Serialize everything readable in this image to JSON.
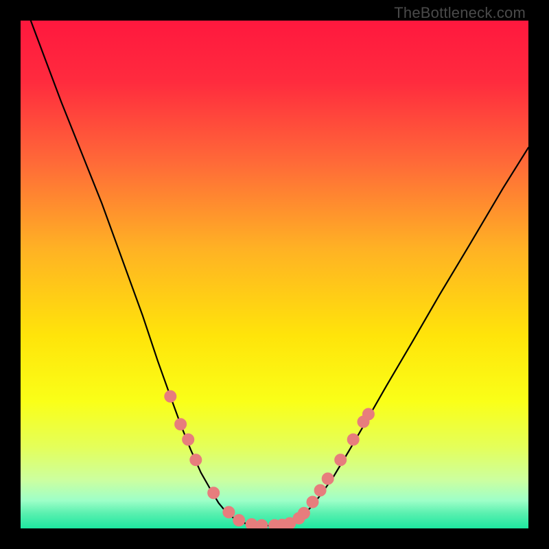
{
  "watermark": "TheBottleneck.com",
  "colors": {
    "bg": "#000000",
    "gradient_stops": [
      {
        "offset": 0.0,
        "color": "#ff183e"
      },
      {
        "offset": 0.12,
        "color": "#ff2b3e"
      },
      {
        "offset": 0.28,
        "color": "#ff6a38"
      },
      {
        "offset": 0.45,
        "color": "#ffb224"
      },
      {
        "offset": 0.62,
        "color": "#ffe40a"
      },
      {
        "offset": 0.75,
        "color": "#faff18"
      },
      {
        "offset": 0.84,
        "color": "#e4ff5a"
      },
      {
        "offset": 0.905,
        "color": "#ccffa0"
      },
      {
        "offset": 0.945,
        "color": "#9effc8"
      },
      {
        "offset": 0.97,
        "color": "#5af0b0"
      },
      {
        "offset": 1.0,
        "color": "#1de8a0"
      }
    ],
    "curve": "#000000",
    "marker_fill": "#e77d7d",
    "marker_stroke": "#e77d7d"
  },
  "chart_data": {
    "type": "line",
    "title": "",
    "xlabel": "",
    "ylabel": "",
    "xlim": [
      0,
      100
    ],
    "ylim": [
      0,
      100
    ],
    "series": [
      {
        "name": "left-curve",
        "x": [
          2,
          5,
          8,
          12,
          16,
          20,
          24,
          27,
          29.5,
          31.5,
          33.5,
          35.5,
          37.5,
          39,
          40.5,
          42,
          43.5,
          45
        ],
        "y": [
          100,
          92,
          84,
          74,
          64,
          53,
          42,
          33,
          26,
          20.5,
          15.5,
          11,
          7.5,
          5,
          3.2,
          2,
          1.2,
          0.8
        ]
      },
      {
        "name": "valley-floor",
        "x": [
          45,
          46.5,
          48,
          49.5,
          51,
          52.5
        ],
        "y": [
          0.8,
          0.6,
          0.55,
          0.55,
          0.6,
          0.8
        ]
      },
      {
        "name": "right-curve",
        "x": [
          52.5,
          54,
          55.5,
          57,
          59,
          61.5,
          64.5,
          68,
          72,
          77,
          82.5,
          88.5,
          95,
          100
        ],
        "y": [
          0.8,
          1.4,
          2.5,
          4,
          6.5,
          10,
          15,
          21,
          28,
          36.5,
          46,
          56,
          67,
          75
        ]
      }
    ],
    "markers": {
      "name": "highlighted-points",
      "points": [
        {
          "x": 29.5,
          "y": 26
        },
        {
          "x": 31.5,
          "y": 20.5
        },
        {
          "x": 33.0,
          "y": 17.5
        },
        {
          "x": 34.5,
          "y": 13.5
        },
        {
          "x": 38.0,
          "y": 7.0
        },
        {
          "x": 41.0,
          "y": 3.2
        },
        {
          "x": 43.0,
          "y": 1.6
        },
        {
          "x": 45.5,
          "y": 0.8
        },
        {
          "x": 47.5,
          "y": 0.6
        },
        {
          "x": 50.0,
          "y": 0.6
        },
        {
          "x": 51.5,
          "y": 0.7
        },
        {
          "x": 53.0,
          "y": 1.0
        },
        {
          "x": 54.8,
          "y": 2.0
        },
        {
          "x": 55.8,
          "y": 3.0
        },
        {
          "x": 57.5,
          "y": 5.2
        },
        {
          "x": 59.0,
          "y": 7.5
        },
        {
          "x": 60.5,
          "y": 9.8
        },
        {
          "x": 63.0,
          "y": 13.5
        },
        {
          "x": 65.5,
          "y": 17.5
        },
        {
          "x": 67.5,
          "y": 21.0
        },
        {
          "x": 68.5,
          "y": 22.5
        }
      ]
    }
  }
}
